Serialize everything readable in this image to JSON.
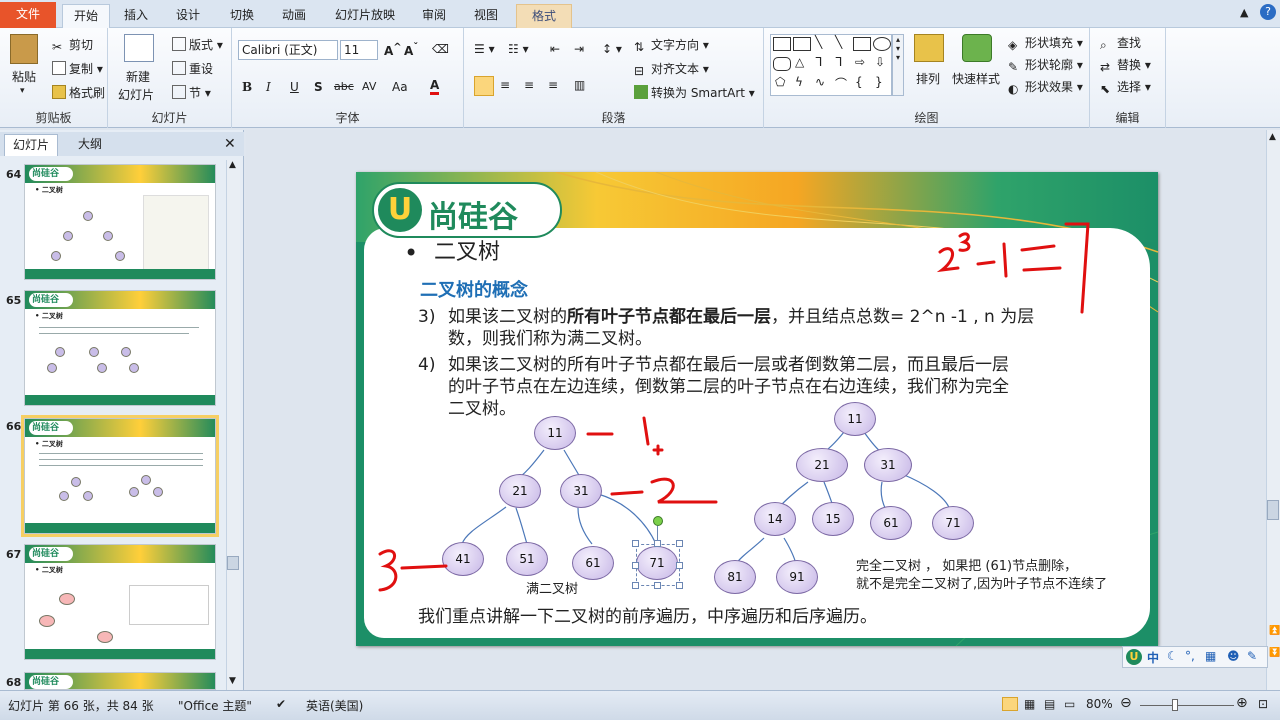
{
  "tabs": [
    "文件",
    "开始",
    "插入",
    "设计",
    "切换",
    "动画",
    "幻灯片放映",
    "审阅",
    "视图",
    "格式"
  ],
  "ribbon": {
    "clipboard": {
      "paste": "粘贴",
      "cut": "剪切",
      "copy": "复制",
      "format_painter": "格式刷",
      "label": "剪贴板"
    },
    "slides": {
      "new_slide_1": "新建",
      "new_slide_2": "幻灯片",
      "layout": "版式",
      "reset": "重设",
      "section": "节",
      "label": "幻灯片"
    },
    "font": {
      "name": "Calibri (正文)",
      "size": "11",
      "bold": "B",
      "italic": "I",
      "underline": "U",
      "shadow": "S",
      "strike": "abc",
      "spacing": "AV",
      "case": "Aa",
      "color": "A",
      "label": "字体"
    },
    "paragraph": {
      "text_direction": "文字方向",
      "align_text": "对齐文本",
      "smartart": "转换为 SmartArt",
      "label": "段落"
    },
    "drawing": {
      "arrange": "排列",
      "quick_styles": "快速样式",
      "shape_fill": "形状填充",
      "shape_outline": "形状轮廓",
      "shape_effects": "形状效果",
      "label": "绘图"
    },
    "editing": {
      "find": "查找",
      "replace": "替换",
      "select": "选择",
      "label": "编辑"
    }
  },
  "leftpane": {
    "tabs": [
      "幻灯片",
      "大纲"
    ],
    "thumbs": [
      {
        "num": "64",
        "logo": "尚硅谷",
        "title": "• 二叉树"
      },
      {
        "num": "65",
        "logo": "尚硅谷",
        "title": "• 二叉树"
      },
      {
        "num": "66",
        "logo": "尚硅谷",
        "title": "• 二叉树"
      },
      {
        "num": "67",
        "logo": "尚硅谷",
        "title": "• 二叉树"
      },
      {
        "num": "68",
        "logo": "尚硅谷",
        "title": ""
      }
    ]
  },
  "slide": {
    "logo": "尚硅谷",
    "title": "二叉树",
    "subtitle": "二叉树的概念",
    "item3_num": "3)",
    "item3_a": "如果该二叉树的",
    "item3_bold": "所有叶子节点都在最后一层",
    "item3_b": "，并且结点总数= 2^n -1 , n 为层",
    "item3_line2": "数，则我们称为满二叉树。",
    "item4_num": "4)",
    "item4_line1": "如果该二叉树的所有叶子节点都在最后一层或者倒数第二层，而且最后一层",
    "item4_line2": "的叶子节点在左边连续，倒数第二层的叶子节点在右边连续，我们称为完全",
    "item4_line3": "二叉树。",
    "full_tree_label": "满二叉树",
    "complete_note_1": "完全二叉树 ， 如果把 (61)节点删除，",
    "complete_note_2": "就不是完全二叉树了,因为叶子节点不连续了",
    "footer": "我们重点讲解一下二叉树的前序遍历，中序遍历和后序遍历。",
    "full_nodes": [
      "11",
      "21",
      "31",
      "41",
      "51",
      "61",
      "71"
    ],
    "complete_nodes": [
      "11",
      "21",
      "31",
      "14",
      "15",
      "61",
      "71",
      "81",
      "91"
    ],
    "ink_color": "#e01010"
  },
  "ime": {
    "text": "中"
  },
  "status": {
    "slide_info": "幻灯片 第 66 张，共 84 张",
    "theme": "\"Office 主题\"",
    "language": "英语(美国)",
    "zoom": "80%"
  }
}
